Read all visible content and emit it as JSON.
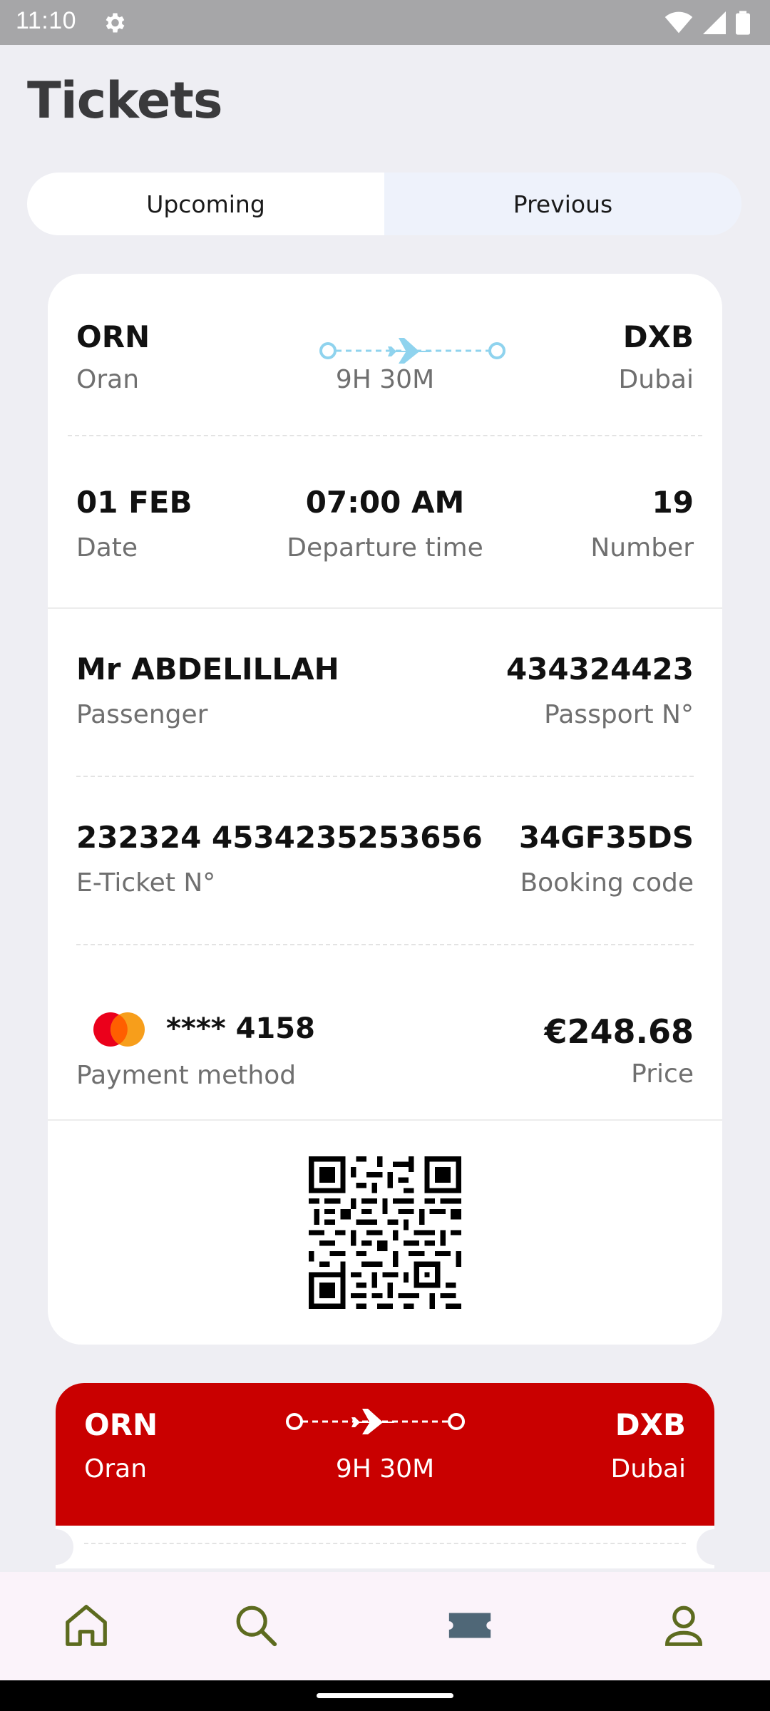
{
  "status_bar": {
    "time": "11:10"
  },
  "header": {
    "title": "Tickets"
  },
  "tabs": [
    {
      "label": "Upcoming",
      "active": true
    },
    {
      "label": "Previous",
      "active": false
    }
  ],
  "ticket": {
    "from": {
      "code": "ORN",
      "city": "Oran"
    },
    "to": {
      "code": "DXB",
      "city": "Dubai"
    },
    "duration": "9H 30M",
    "date": {
      "value": "01 FEB",
      "label": "Date"
    },
    "departure": {
      "value": "07:00 AM",
      "label": "Departure time"
    },
    "number": {
      "value": "19",
      "label": "Number"
    },
    "passenger": {
      "value": "Mr ABDELILLAH",
      "label": "Passenger"
    },
    "passport": {
      "value": "434324423",
      "label": "Passport N°"
    },
    "eticket": {
      "value": "232324 4534235253656",
      "label": "E-Ticket N°"
    },
    "booking": {
      "value": "34GF35DS",
      "label": "Booking code"
    },
    "payment": {
      "value": "**** 4158",
      "label": "Payment method"
    },
    "price": {
      "value": "€248.68",
      "label": "Price"
    }
  },
  "ticket2": {
    "from": {
      "code": "ORN",
      "city": "Oran"
    },
    "to": {
      "code": "DXB",
      "city": "Dubai"
    },
    "duration": "9H 30M"
  },
  "colors": {
    "accent_red": "#c90000",
    "route_blue": "#8fd3ee",
    "nav_icon": "#5d6b1f",
    "active_ticket_icon": "#4f6777"
  },
  "bottom_nav": [
    {
      "icon": "home-icon"
    },
    {
      "icon": "search-icon"
    },
    {
      "icon": "ticket-icon"
    },
    {
      "icon": "profile-icon"
    }
  ]
}
